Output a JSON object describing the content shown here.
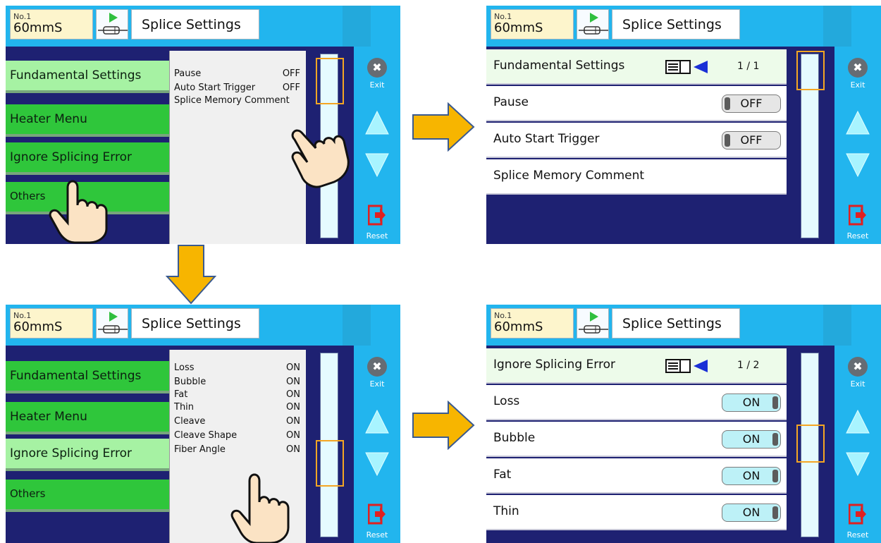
{
  "common": {
    "program_no": "No.1",
    "program_name": "60mmS",
    "title": "Splice Settings",
    "exit_label": "Exit",
    "reset_label": "Reset"
  },
  "panel1": {
    "menu": [
      "Fundamental Settings",
      "Heater Menu",
      "Ignore Splicing Error",
      "Others"
    ],
    "preview": [
      {
        "label": "Pause",
        "value": "OFF"
      },
      {
        "label": "Auto Start Trigger",
        "value": "OFF"
      },
      {
        "label": "Splice Memory Comment",
        "value": ""
      }
    ]
  },
  "panel2": {
    "header": "Fundamental Settings",
    "page": "1 / 1",
    "rows": [
      {
        "label": "Pause",
        "toggle": "OFF"
      },
      {
        "label": "Auto Start Trigger",
        "toggle": "OFF"
      },
      {
        "label": "Splice Memory Comment",
        "toggle": ""
      }
    ]
  },
  "panel3": {
    "menu": [
      "Fundamental Settings",
      "Heater Menu",
      "Ignore Splicing Error",
      "Others"
    ],
    "preview": [
      {
        "label": "Loss",
        "value": "ON"
      },
      {
        "label": "Bubble",
        "value": "ON"
      },
      {
        "label": "Fat",
        "value": "ON"
      },
      {
        "label": "Thin",
        "value": "ON"
      },
      {
        "label": "Cleave",
        "value": "ON"
      },
      {
        "label": "Cleave Shape",
        "value": "ON"
      },
      {
        "label": "Fiber Angle",
        "value": "ON"
      }
    ]
  },
  "panel4": {
    "header": "Ignore Splicing Error",
    "page": "1 / 2",
    "rows": [
      {
        "label": "Loss",
        "toggle": "ON"
      },
      {
        "label": "Bubble",
        "toggle": "ON"
      },
      {
        "label": "Fat",
        "toggle": "ON"
      },
      {
        "label": "Thin",
        "toggle": "ON"
      }
    ]
  },
  "colors": {
    "topbar": "#22b5ee",
    "background": "#1e2172",
    "menu_green": "#2fc63b",
    "menu_selected": "#a6f2a3",
    "flow_arrow": "#f7b500",
    "scroll_thumb": "#f5a623"
  }
}
